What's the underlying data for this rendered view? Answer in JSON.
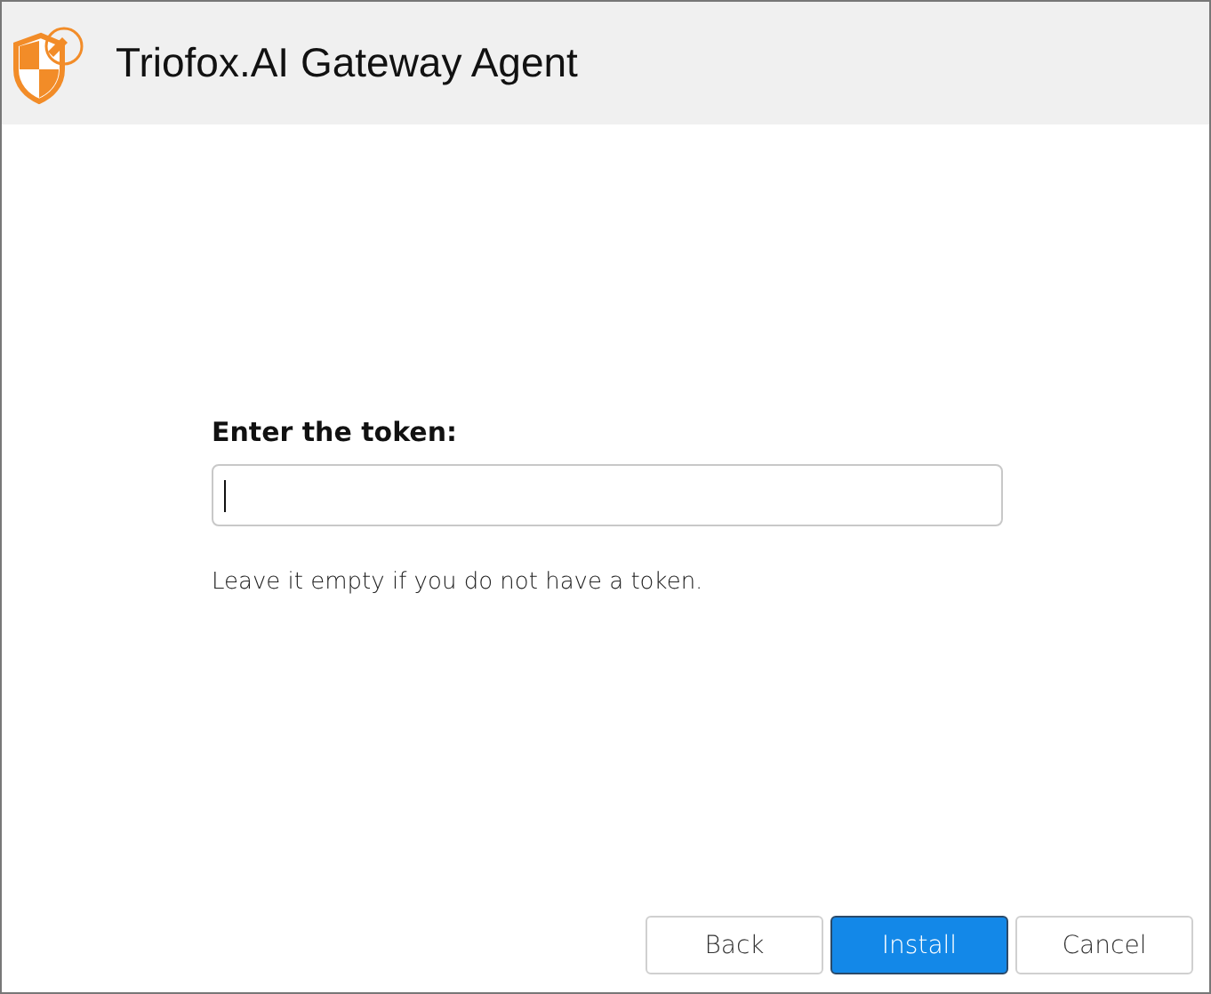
{
  "window": {
    "title": "Triofox.AI Gateway Agent"
  },
  "token": {
    "label": "Enter the token:",
    "focused": true,
    "hint": "Leave it empty if you do not have a token."
  },
  "buttons": [
    {
      "label": "Back",
      "kind": "default"
    },
    {
      "label": "Install",
      "kind": "primary"
    },
    {
      "label": "Cancel",
      "kind": "default"
    }
  ]
}
